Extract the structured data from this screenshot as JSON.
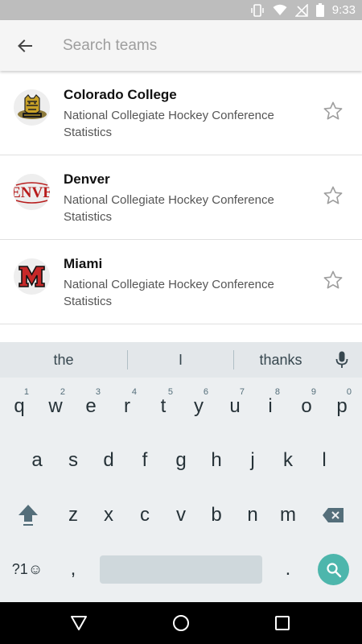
{
  "status_bar": {
    "time": "9:33",
    "icons": [
      "vibrate-icon",
      "wifi-icon",
      "no-signal-icon",
      "battery-icon"
    ]
  },
  "search": {
    "placeholder": "Search teams",
    "value": "",
    "back_icon": "back-arrow-icon"
  },
  "teams": [
    {
      "name": "Colorado College",
      "subtitle": "National Collegiate Hockey Conference Statistics",
      "logo": "colorado-college-logo",
      "favorite": false
    },
    {
      "name": "Denver",
      "subtitle": "National Collegiate Hockey Conference Statistics",
      "logo": "denver-logo",
      "favorite": false,
      "logo_text": "ENVE"
    },
    {
      "name": "Miami",
      "subtitle": "National Collegiate Hockey Conference Statistics",
      "logo": "miami-logo",
      "favorite": false
    }
  ],
  "keyboard": {
    "suggestions": [
      "the",
      "I",
      "thanks"
    ],
    "row1": [
      "q",
      "w",
      "e",
      "r",
      "t",
      "y",
      "u",
      "i",
      "o",
      "p"
    ],
    "row1_hints": [
      "1",
      "2",
      "3",
      "4",
      "5",
      "6",
      "7",
      "8",
      "9",
      "0"
    ],
    "row2": [
      "a",
      "s",
      "d",
      "f",
      "g",
      "h",
      "j",
      "k",
      "l"
    ],
    "row3": [
      "z",
      "x",
      "c",
      "v",
      "b",
      "n",
      "m"
    ],
    "symbols_label": "?1☺",
    "comma": ",",
    "period": "."
  },
  "colors": {
    "status_bar": "#bdbdbd",
    "search_bar": "#f5f5f5",
    "keyboard_bg": "#eceff1",
    "search_fab": "#4db6ac",
    "denver_red": "#b71c1c",
    "miami_red": "#c62828"
  }
}
